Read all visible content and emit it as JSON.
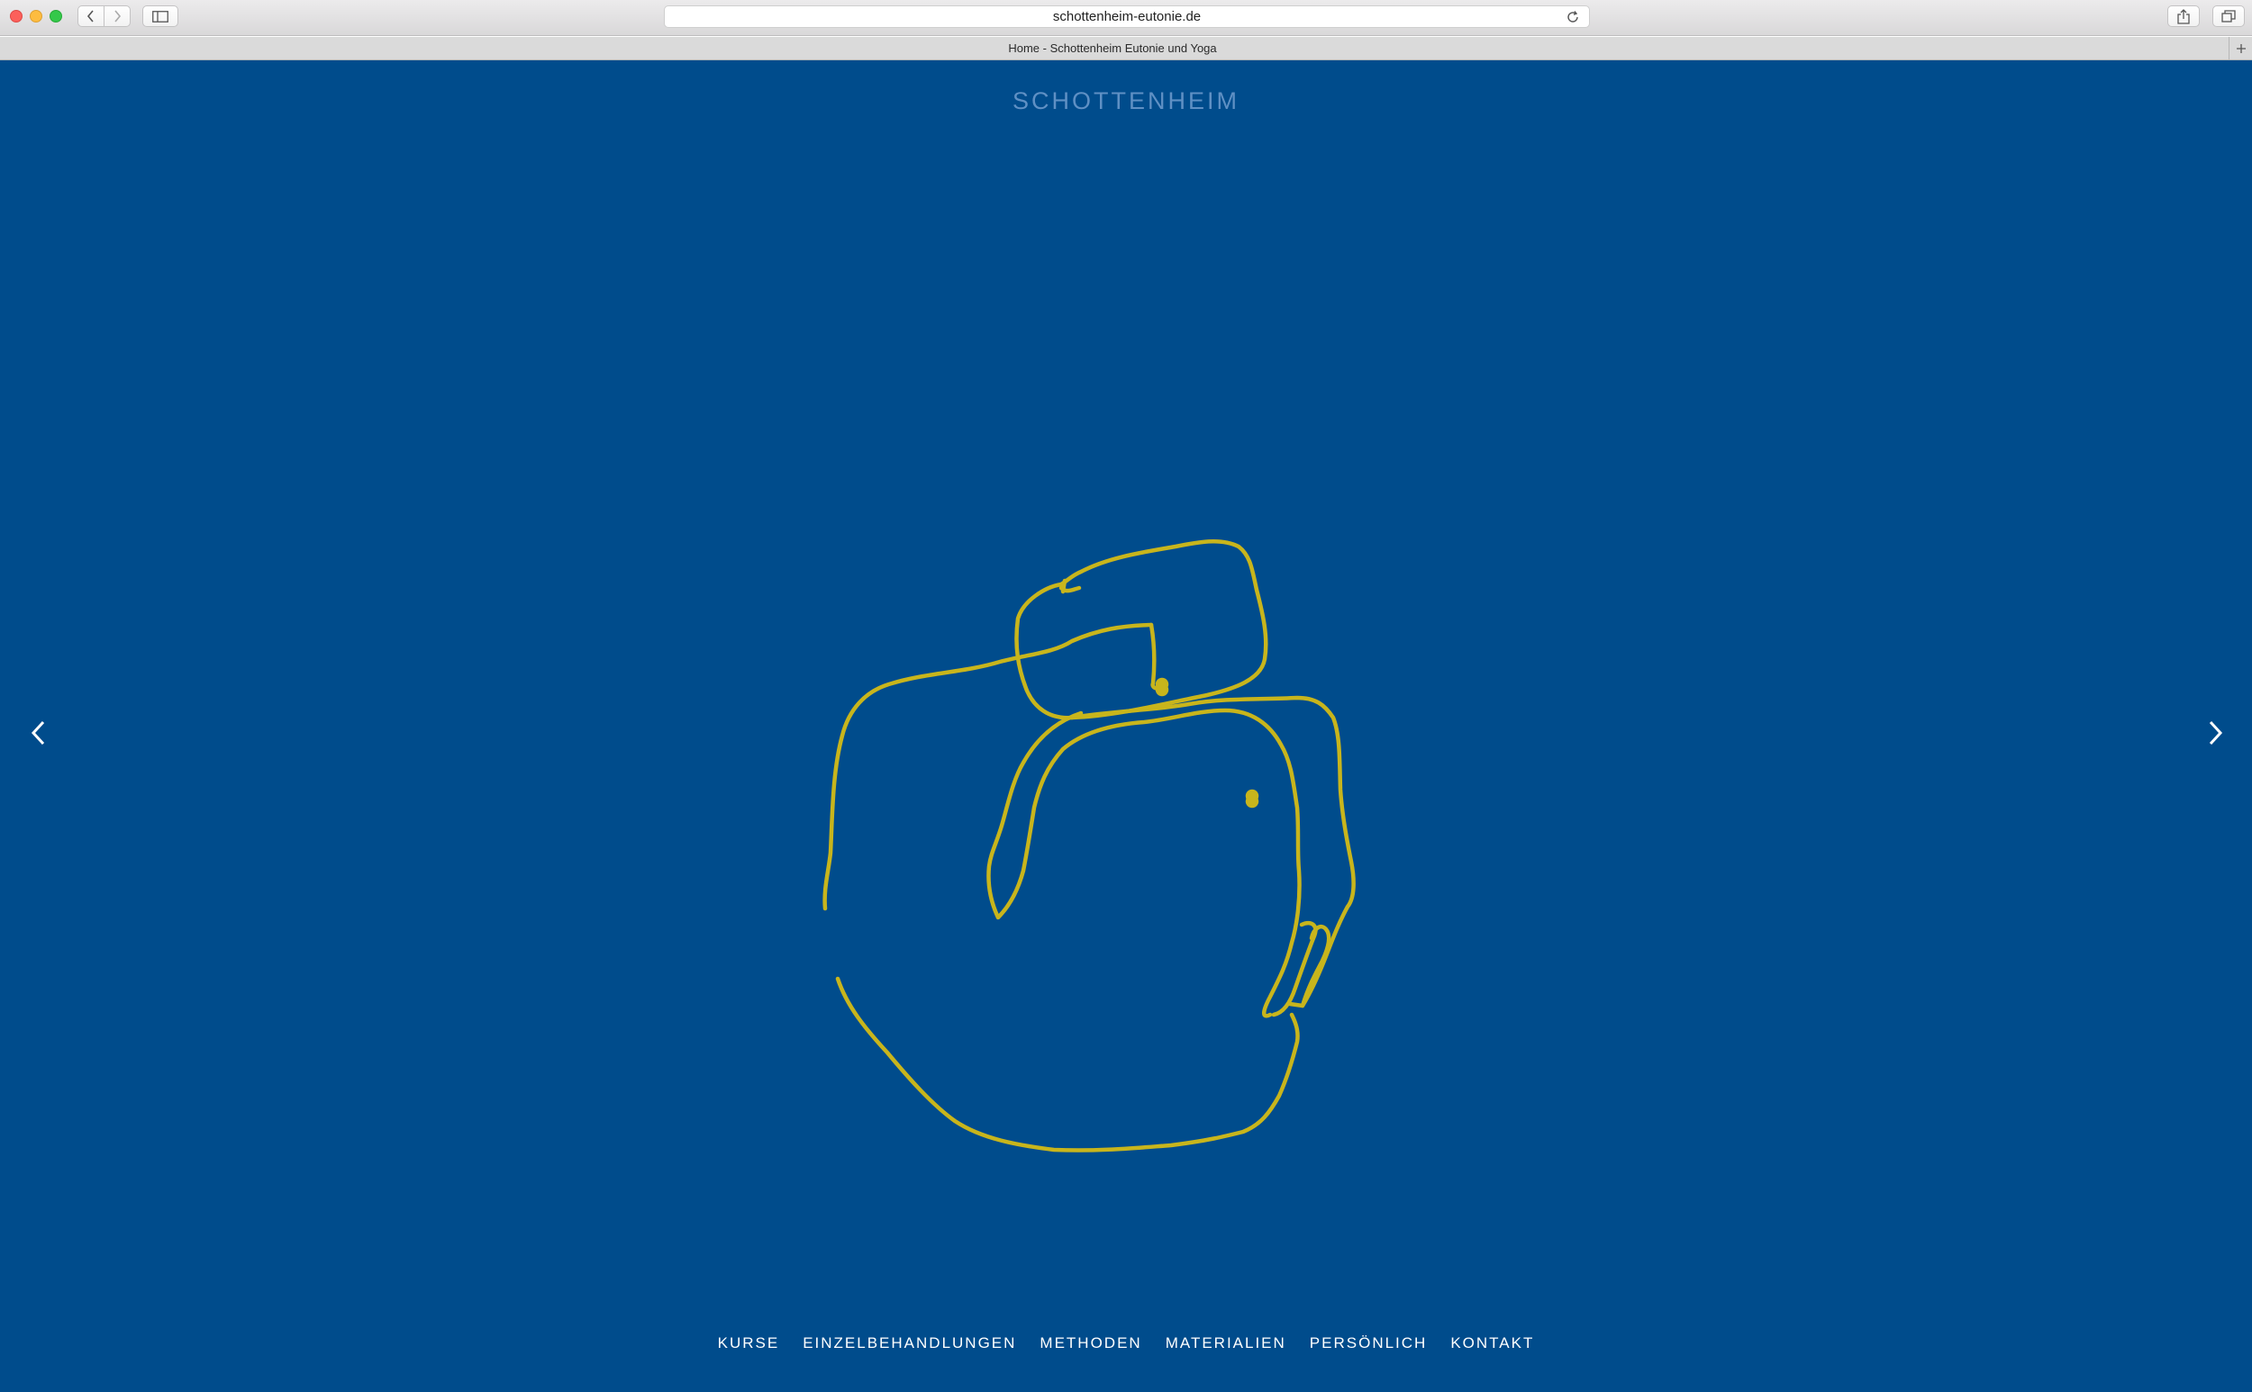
{
  "browser": {
    "url": "schottenheim-eutonie.de",
    "tab_title": "Home - Schottenheim Eutonie und Yoga"
  },
  "site": {
    "logo_text": "SCHOTTENHEIM",
    "background_color": "#004c8c",
    "logo_color": "#5f90c4",
    "illustration_color": "#c8b51c"
  },
  "slider": {
    "prev_icon": "chevron-left-icon",
    "next_icon": "chevron-right-icon"
  },
  "nav": {
    "items": [
      {
        "label": "KURSE"
      },
      {
        "label": "EINZELBEHANDLUNGEN"
      },
      {
        "label": "METHODEN"
      },
      {
        "label": "MATERIALIEN"
      },
      {
        "label": "PERSÖNLICH"
      },
      {
        "label": "KONTAKT"
      }
    ]
  }
}
